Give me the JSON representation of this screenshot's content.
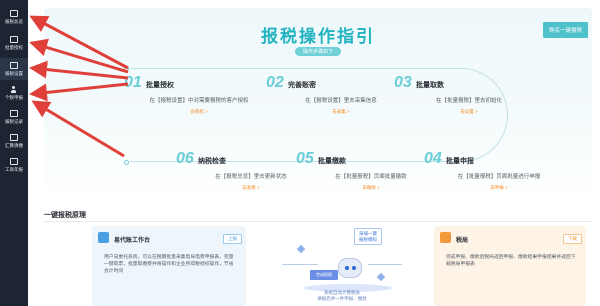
{
  "sidebar": {
    "items": [
      {
        "label": "报税总览",
        "active": false
      },
      {
        "label": "批量授权",
        "active": false
      },
      {
        "label": "报税设置",
        "active": true
      },
      {
        "label": "个税申报",
        "active": false
      },
      {
        "label": "报税记录",
        "active": false
      },
      {
        "label": "汇算清缴",
        "active": false
      },
      {
        "label": "工商年报",
        "active": false
      }
    ]
  },
  "guide": {
    "title": "报税操作指引",
    "subtitle": "操作步骤如下",
    "buy_button": "购买一键报税",
    "steps": [
      {
        "num": "01",
        "name": "批量授权",
        "desc": "在【报税设置】中对需要报税的客户授权",
        "link": "去授权 >"
      },
      {
        "num": "02",
        "name": "完善账密",
        "desc": "在【报税设置】里去采集信息",
        "link": "去采集 >"
      },
      {
        "num": "03",
        "name": "批量取数",
        "desc": "在【批量报税】里去初始化",
        "link": "去设置 >"
      },
      {
        "num": "04",
        "name": "批量申报",
        "desc": "在【批量报税】页面批量进行申报",
        "link": "去申报 >"
      },
      {
        "num": "05",
        "name": "批量缴款",
        "desc": "在【批量报税】页面批量缴款",
        "link": "去缴款 >"
      },
      {
        "num": "06",
        "name": "纳税检查",
        "desc": "在【报税总览】里去更新状态",
        "link": "去查看 >"
      }
    ]
  },
  "principle": {
    "title": "一键报税原理",
    "left_card": {
      "name": "易代账工作台",
      "tag": "上报",
      "desc": "用户向委托系统，可以在税期批量采集电局电费申报表，完量一键取票，批量取缴费并将操作和企业所得税授权操作，节省会计时间"
    },
    "right_card": {
      "name": "税局",
      "tag": "下载",
      "desc": "完成申报、缴款后税局返回申报、缴款结果申报结果并返回下载税局申报表"
    },
    "illustration": {
      "bubble_line1": "采埔一键",
      "bubble_line2": "报税模拟",
      "screen_label": "完成报税",
      "caption_line1": "系统自动计算税表",
      "caption_line2": "填报后并一件申报、缴款"
    }
  },
  "colors": {
    "sidebar_bg": "#1d2532",
    "accent": "#22b3c0",
    "link": "#f08b22",
    "arrow_annotation": "#e0403a"
  }
}
